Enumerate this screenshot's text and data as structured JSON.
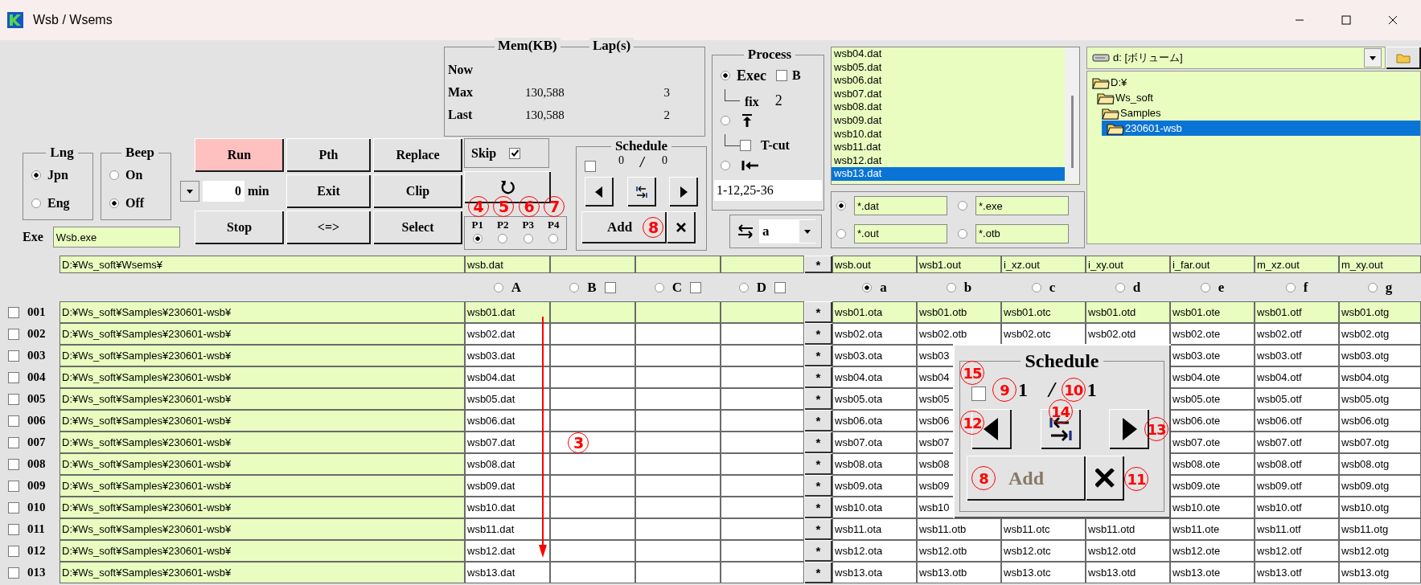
{
  "window": {
    "title": "Wsb / Wsems"
  },
  "memory": {
    "columns": [
      "Mem(KB)",
      "Lap(s)"
    ],
    "rows": [
      {
        "label": "Now"
      },
      {
        "label": "Max",
        "mem": "130,588",
        "lap": "3"
      },
      {
        "label": "Last",
        "mem": "130,588",
        "lap": "2"
      }
    ]
  },
  "process": {
    "title": "Process",
    "modes": [
      {
        "kind": "exec",
        "label": "Exec",
        "selected": true
      },
      {
        "kind": "top",
        "selected": false
      },
      {
        "kind": "start",
        "selected": false
      }
    ],
    "b": {
      "label": "B",
      "checked": false
    },
    "fix": {
      "label": "fix",
      "value": "2"
    },
    "tcut": {
      "label": "T-cut",
      "checked": false
    },
    "range": "1-12,25-36"
  },
  "file_list": {
    "items": [
      {
        "name": "wsb04.dat",
        "selected": false
      },
      {
        "name": "wsb05.dat",
        "selected": false
      },
      {
        "name": "wsb06.dat",
        "selected": false
      },
      {
        "name": "wsb07.dat",
        "selected": false
      },
      {
        "name": "wsb08.dat",
        "selected": false
      },
      {
        "name": "wsb09.dat",
        "selected": false
      },
      {
        "name": "wsb10.dat",
        "selected": false
      },
      {
        "name": "wsb11.dat",
        "selected": false
      },
      {
        "name": "wsb12.dat",
        "selected": false
      },
      {
        "name": "wsb13.dat",
        "selected": true
      }
    ]
  },
  "filters": [
    {
      "pattern": "*.dat",
      "selected": true
    },
    {
      "pattern": "*.exe",
      "selected": false
    },
    {
      "pattern": "*.out",
      "selected": false
    },
    {
      "pattern": "*.otb",
      "selected": false
    }
  ],
  "drive": {
    "label": "d: [ボリューム]"
  },
  "folders": [
    {
      "name": "D:¥",
      "selected": false,
      "children": [
        {
          "name": "Ws_soft",
          "selected": false,
          "children": [
            {
              "name": "Samples",
              "selected": false,
              "children": [
                {
                  "name": "230601-wsb",
                  "selected": true
                }
              ]
            }
          ]
        }
      ]
    }
  ],
  "language": {
    "title": "Lng",
    "options": [
      {
        "label": "Jpn",
        "selected": true
      },
      {
        "label": "Eng",
        "selected": false
      }
    ]
  },
  "beep": {
    "title": "Beep",
    "options": [
      {
        "label": "On",
        "selected": false
      },
      {
        "label": "Off",
        "selected": true
      }
    ]
  },
  "buttons": [
    {
      "label": "Run",
      "highlighted": true
    },
    {
      "label": "Pth",
      "highlighted": false
    },
    {
      "label": "Replace",
      "highlighted": false
    },
    {
      "label": "Exit",
      "highlighted": false
    },
    {
      "label": "Clip",
      "highlighted": false
    },
    {
      "label": "Stop",
      "highlighted": false
    },
    {
      "label": "<=>",
      "highlighted": false
    },
    {
      "label": "Select",
      "highlighted": false
    }
  ],
  "timer": {
    "value": "0",
    "unit": "min"
  },
  "skip": {
    "label": "Skip",
    "checked": true
  },
  "priorities": [
    {
      "label": "P1",
      "selected": true,
      "marker": "4"
    },
    {
      "label": "P2",
      "selected": false,
      "marker": "5"
    },
    {
      "label": "P3",
      "selected": false,
      "marker": "6"
    },
    {
      "label": "P4",
      "selected": false,
      "marker": "7"
    }
  ],
  "schedule": {
    "title": "Schedule",
    "checked": false,
    "current": "0",
    "separator": "/",
    "total": "0",
    "add": {
      "label": "Add",
      "disabled": false,
      "marker": "8"
    }
  },
  "swap": {
    "value": "a"
  },
  "exe": {
    "label": "Exe",
    "value": "Wsb.exe"
  },
  "table": {
    "base_path": "D:¥Ws_soft¥Wsems¥",
    "header_button": "*",
    "marker": "3",
    "input_columns": [
      {
        "label": "A",
        "selected": false,
        "file": "wsb.dat"
      },
      {
        "label": "B",
        "selected": false,
        "checked": false
      },
      {
        "label": "C",
        "selected": false,
        "checked": false
      },
      {
        "label": "D",
        "selected": false,
        "checked": false
      }
    ],
    "output_columns": [
      {
        "label": "a",
        "selected": true,
        "file": "wsb.out"
      },
      {
        "label": "b",
        "selected": false,
        "file": "wsb1.out"
      },
      {
        "label": "c",
        "selected": false,
        "file": "i_xz.out"
      },
      {
        "label": "d",
        "selected": false,
        "file": "i_xy.out"
      },
      {
        "label": "e",
        "selected": false,
        "file": "i_far.out"
      },
      {
        "label": "f",
        "selected": false,
        "file": "m_xz.out"
      },
      {
        "label": "g",
        "selected": false,
        "file": "m_xy.out"
      }
    ],
    "rows": [
      {
        "number": "001",
        "checked": false,
        "current": true,
        "path": "D:¥Ws_soft¥Samples¥230601-wsb¥",
        "input": "wsb01.dat",
        "button": "*",
        "outputs": [
          "wsb01.ota",
          "wsb01.otb",
          "wsb01.otc",
          "wsb01.otd",
          "wsb01.ote",
          "wsb01.otf",
          "wsb01.otg"
        ]
      },
      {
        "number": "002",
        "checked": false,
        "current": false,
        "path": "D:¥Ws_soft¥Samples¥230601-wsb¥",
        "input": "wsb02.dat",
        "button": "*",
        "outputs": [
          "wsb02.ota",
          "wsb02.otb",
          "wsb02.otc",
          "wsb02.otd",
          "wsb02.ote",
          "wsb02.otf",
          "wsb02.otg"
        ]
      },
      {
        "number": "003",
        "checked": false,
        "current": false,
        "path": "D:¥Ws_soft¥Samples¥230601-wsb¥",
        "input": "wsb03.dat",
        "button": "*",
        "outputs_left": [
          "wsb03.ota",
          "wsb03"
        ],
        "outputs_right": [
          "wsb03.ote",
          "wsb03.otf",
          "wsb03.otg"
        ]
      },
      {
        "number": "004",
        "checked": false,
        "current": false,
        "path": "D:¥Ws_soft¥Samples¥230601-wsb¥",
        "input": "wsb04.dat",
        "button": "*",
        "outputs_left": [
          "wsb04.ota",
          "wsb04"
        ],
        "outputs_right": [
          "wsb04.ote",
          "wsb04.otf",
          "wsb04.otg"
        ]
      },
      {
        "number": "005",
        "checked": false,
        "current": false,
        "path": "D:¥Ws_soft¥Samples¥230601-wsb¥",
        "input": "wsb05.dat",
        "button": "*",
        "outputs_left": [
          "wsb05.ota",
          "wsb05"
        ],
        "outputs_right": [
          "wsb05.ote",
          "wsb05.otf",
          "wsb05.otg"
        ]
      },
      {
        "number": "006",
        "checked": false,
        "current": false,
        "path": "D:¥Ws_soft¥Samples¥230601-wsb¥",
        "input": "wsb06.dat",
        "button": "*",
        "outputs_left": [
          "wsb06.ota",
          "wsb06"
        ],
        "outputs_right": [
          "wsb06.ote",
          "wsb06.otf",
          "wsb06.otg"
        ]
      },
      {
        "number": "007",
        "checked": false,
        "current": false,
        "path": "D:¥Ws_soft¥Samples¥230601-wsb¥",
        "input": "wsb07.dat",
        "button": "*",
        "outputs_left": [
          "wsb07.ota",
          "wsb07"
        ],
        "outputs_right": [
          "wsb07.ote",
          "wsb07.otf",
          "wsb07.otg"
        ]
      },
      {
        "number": "008",
        "checked": false,
        "current": false,
        "path": "D:¥Ws_soft¥Samples¥230601-wsb¥",
        "input": "wsb08.dat",
        "button": "*",
        "outputs_left": [
          "wsb08.ota",
          "wsb08"
        ],
        "outputs_right": [
          "wsb08.ote",
          "wsb08.otf",
          "wsb08.otg"
        ]
      },
      {
        "number": "009",
        "checked": false,
        "current": false,
        "path": "D:¥Ws_soft¥Samples¥230601-wsb¥",
        "input": "wsb09.dat",
        "button": "*",
        "outputs_left": [
          "wsb09.ota",
          "wsb09"
        ],
        "outputs_right": [
          "wsb09.ote",
          "wsb09.otf",
          "wsb09.otg"
        ]
      },
      {
        "number": "010",
        "checked": false,
        "current": false,
        "path": "D:¥Ws_soft¥Samples¥230601-wsb¥",
        "input": "wsb10.dat",
        "button": "*",
        "outputs_left": [
          "wsb10.ota",
          "wsb10"
        ],
        "outputs_right": [
          "wsb10.ote",
          "wsb10.otf",
          "wsb10.otg"
        ]
      },
      {
        "number": "011",
        "checked": false,
        "current": false,
        "path": "D:¥Ws_soft¥Samples¥230601-wsb¥",
        "input": "wsb11.dat",
        "button": "*",
        "outputs": [
          "wsb11.ota",
          "wsb11.otb",
          "wsb11.otc",
          "wsb11.otd",
          "wsb11.ote",
          "wsb11.otf",
          "wsb11.otg"
        ]
      },
      {
        "number": "012",
        "checked": false,
        "current": false,
        "path": "D:¥Ws_soft¥Samples¥230601-wsb¥",
        "input": "wsb12.dat",
        "button": "*",
        "outputs": [
          "wsb12.ota",
          "wsb12.otb",
          "wsb12.otc",
          "wsb12.otd",
          "wsb12.ote",
          "wsb12.otf",
          "wsb12.otg"
        ]
      },
      {
        "number": "013",
        "checked": false,
        "current": false,
        "path": "D:¥Ws_soft¥Samples¥230601-wsb¥",
        "input": "wsb13.dat",
        "button": "*",
        "outputs": [
          "wsb13.ota",
          "wsb13.otb",
          "wsb13.otc",
          "wsb13.otd",
          "wsb13.ote",
          "wsb13.otf",
          "wsb13.otg"
        ]
      }
    ]
  },
  "schedule_zoom": {
    "title": "Schedule",
    "checked": false,
    "check_marker": "15",
    "current_marker": "9",
    "current": "1",
    "separator": "/",
    "total_marker": "10",
    "total": "1",
    "prev_marker": "12",
    "jump_marker": "14",
    "next_marker": "13",
    "delete_marker": "11",
    "add": {
      "label": "Add",
      "disabled": true,
      "marker": "8"
    }
  }
}
